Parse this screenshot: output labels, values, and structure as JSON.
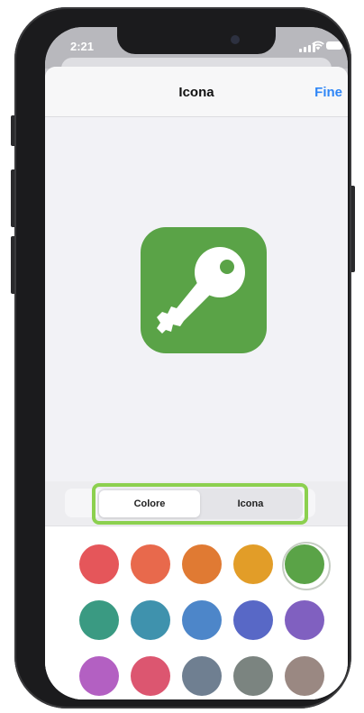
{
  "status": {
    "time": "2:21"
  },
  "nav": {
    "title": "Icona",
    "done_label": "Fine"
  },
  "preview": {
    "icon": "key-icon",
    "color": "#5aa347"
  },
  "segments": [
    {
      "label": "Colore",
      "active": true
    },
    {
      "label": "Icona",
      "active": false
    }
  ],
  "highlight_color": "#8cd04f",
  "colors": [
    {
      "name": "red",
      "hex": "#e5565a"
    },
    {
      "name": "coral",
      "hex": "#e8694c"
    },
    {
      "name": "orange",
      "hex": "#e07a33"
    },
    {
      "name": "yellow",
      "hex": "#e29d28"
    },
    {
      "name": "green",
      "hex": "#5aa347",
      "selected": true
    },
    {
      "name": "teal",
      "hex": "#3a9a82"
    },
    {
      "name": "cyan",
      "hex": "#3f92ad"
    },
    {
      "name": "blue",
      "hex": "#4d86c9"
    },
    {
      "name": "indigo",
      "hex": "#5868c6"
    },
    {
      "name": "purple",
      "hex": "#8060c0"
    },
    {
      "name": "magenta",
      "hex": "#b360c2"
    },
    {
      "name": "pink",
      "hex": "#dc5670"
    },
    {
      "name": "slate",
      "hex": "#6f7f91"
    },
    {
      "name": "gray",
      "hex": "#7b8480"
    },
    {
      "name": "taupe",
      "hex": "#9a8882"
    }
  ]
}
